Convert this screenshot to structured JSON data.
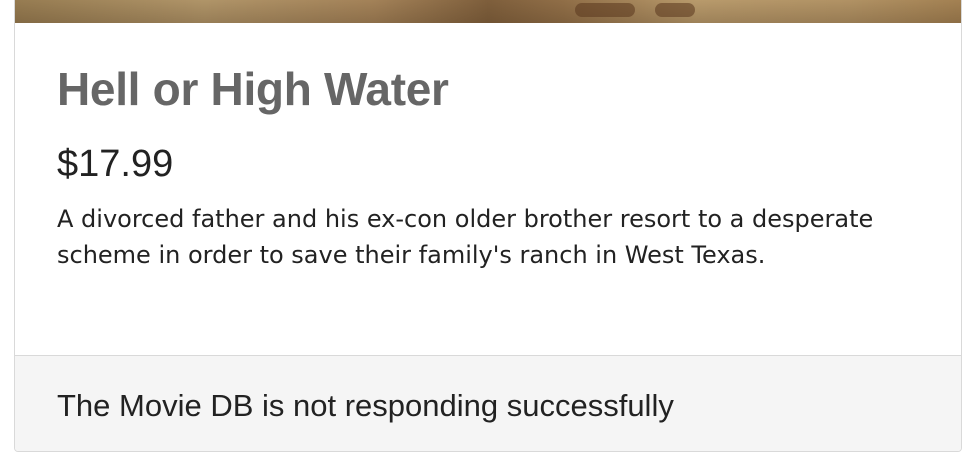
{
  "movie": {
    "title": "Hell or High Water",
    "price": "$17.99",
    "description": "A divorced father and his ex-con older brother resort to a desperate scheme in order to save their family's ranch in West Texas."
  },
  "footer": {
    "status_message": "The Movie DB is not responding successfully"
  }
}
